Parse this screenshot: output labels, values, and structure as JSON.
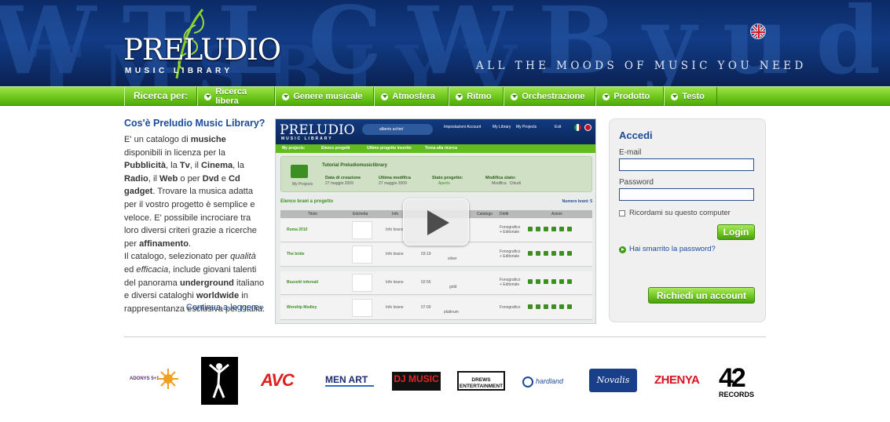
{
  "header": {
    "logo_title": "PRELUDIO",
    "logo_subtitle": "MUSIC LIBRARY",
    "tagline": "ALL THE MOODS OF MUSIC YOU NEED",
    "bg_letters_1": "W T L C W B y u d V p W L C M B",
    "bg_letters_2": "T M S B I Y V",
    "language_flag": "uk-flag-icon"
  },
  "nav": {
    "label": "Ricerca per:",
    "items": [
      "Ricerca libera",
      "Genere musicale",
      "Atmosfera",
      "Ritmo",
      "Orchestrazione",
      "Prodotto",
      "Testo"
    ]
  },
  "intro": {
    "title": "Cos'è Preludio Music Library?",
    "more_link": "Continua a leggere»"
  },
  "video": {
    "logo": "PRELUDIO",
    "logo_sub": "MUSIC LIBRARY",
    "user": "alberto achire'",
    "menu": [
      "Impostazioni Account",
      "My Library",
      "My Projects",
      "Exit"
    ],
    "tabs": [
      "My projects:",
      "Elenco progetti",
      "Ultimo progetto inserito",
      "Torna alla ricerca"
    ],
    "folder_label": "My Projects",
    "project_title": "Tutorial Preludiomusiclibrary",
    "meta": [
      {
        "label": "Data di creazione",
        "value": "27 maggio 2009"
      },
      {
        "label": "Ultima modifica",
        "value": "27 maggio 2009"
      },
      {
        "label": "Stato progetto:",
        "value": "Aperto"
      },
      {
        "label": "Modifica stato:",
        "value": "Modifica   Chiudi"
      }
    ],
    "list_title": "Elenco brani a progetto",
    "list_count": "Numero brani: 5",
    "columns": [
      "Titolo",
      "Etichetta",
      "Info",
      "Durata",
      "Livello",
      "Catalogo",
      "Diritti",
      "Azioni"
    ],
    "rows": [
      {
        "title": "Roma 2010",
        "info": "Info brano",
        "duration": "",
        "level": "",
        "rights": "Fonografico + Editoriale"
      },
      {
        "title": "The bride",
        "info": "Info brano",
        "duration": "03:19",
        "level": "silver",
        "rights": "Fonografico + Editoriale"
      },
      {
        "title": "Bozzetti infernali",
        "info": "Info brano",
        "duration": "02:55",
        "level": "gold",
        "rights": "Fonografico + Editoriale"
      },
      {
        "title": "Worship Medley",
        "info": "Info brano",
        "duration": "07:00",
        "level": "platinum",
        "rights": "Fonografico"
      }
    ]
  },
  "login": {
    "title": "Accedi",
    "email_label": "E-mail",
    "password_label": "Password",
    "remember_label": "Ricordami su questo computer",
    "login_button": "Login",
    "forgot_link": "Hai smarrito la password?",
    "signup_button": "Richiedi un account"
  },
  "labels": [
    "ADONYS 5+1",
    "AVC",
    "MEN ART",
    "DJ MUSIC",
    "DREWS ENTERTAINMENT",
    "hardland",
    "Novalis",
    "ZHENYA",
    "42 RECORDS"
  ],
  "colors": {
    "brand_blue": "#1a4a9a",
    "brand_green": "#6dc71c",
    "header_bg": "#0b2a66"
  }
}
